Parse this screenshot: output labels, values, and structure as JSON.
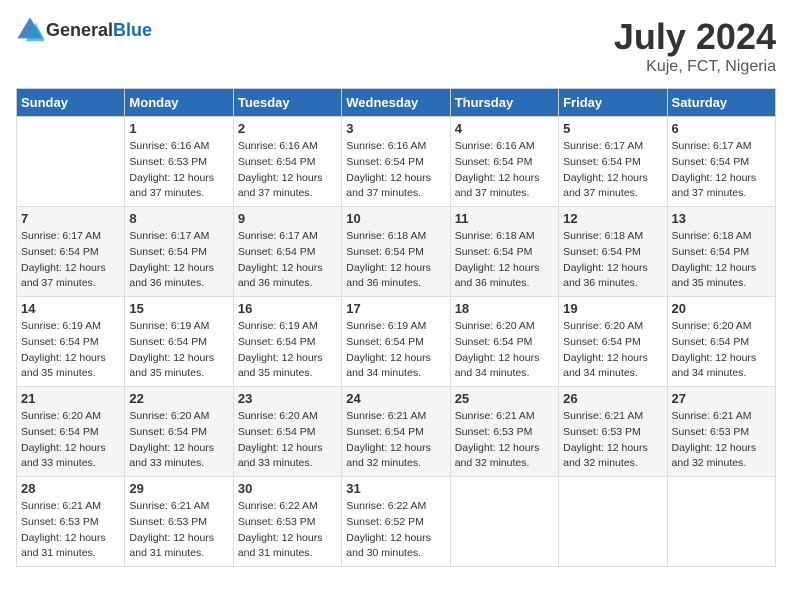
{
  "logo": {
    "general": "General",
    "blue": "Blue"
  },
  "title": "July 2024",
  "location": "Kuje, FCT, Nigeria",
  "days_of_week": [
    "Sunday",
    "Monday",
    "Tuesday",
    "Wednesday",
    "Thursday",
    "Friday",
    "Saturday"
  ],
  "weeks": [
    [
      {
        "day": "",
        "sunrise": "",
        "sunset": "",
        "daylight": ""
      },
      {
        "day": "1",
        "sunrise": "Sunrise: 6:16 AM",
        "sunset": "Sunset: 6:53 PM",
        "daylight": "Daylight: 12 hours and 37 minutes."
      },
      {
        "day": "2",
        "sunrise": "Sunrise: 6:16 AM",
        "sunset": "Sunset: 6:54 PM",
        "daylight": "Daylight: 12 hours and 37 minutes."
      },
      {
        "day": "3",
        "sunrise": "Sunrise: 6:16 AM",
        "sunset": "Sunset: 6:54 PM",
        "daylight": "Daylight: 12 hours and 37 minutes."
      },
      {
        "day": "4",
        "sunrise": "Sunrise: 6:16 AM",
        "sunset": "Sunset: 6:54 PM",
        "daylight": "Daylight: 12 hours and 37 minutes."
      },
      {
        "day": "5",
        "sunrise": "Sunrise: 6:17 AM",
        "sunset": "Sunset: 6:54 PM",
        "daylight": "Daylight: 12 hours and 37 minutes."
      },
      {
        "day": "6",
        "sunrise": "Sunrise: 6:17 AM",
        "sunset": "Sunset: 6:54 PM",
        "daylight": "Daylight: 12 hours and 37 minutes."
      }
    ],
    [
      {
        "day": "7",
        "sunrise": "Sunrise: 6:17 AM",
        "sunset": "Sunset: 6:54 PM",
        "daylight": "Daylight: 12 hours and 37 minutes."
      },
      {
        "day": "8",
        "sunrise": "Sunrise: 6:17 AM",
        "sunset": "Sunset: 6:54 PM",
        "daylight": "Daylight: 12 hours and 36 minutes."
      },
      {
        "day": "9",
        "sunrise": "Sunrise: 6:17 AM",
        "sunset": "Sunset: 6:54 PM",
        "daylight": "Daylight: 12 hours and 36 minutes."
      },
      {
        "day": "10",
        "sunrise": "Sunrise: 6:18 AM",
        "sunset": "Sunset: 6:54 PM",
        "daylight": "Daylight: 12 hours and 36 minutes."
      },
      {
        "day": "11",
        "sunrise": "Sunrise: 6:18 AM",
        "sunset": "Sunset: 6:54 PM",
        "daylight": "Daylight: 12 hours and 36 minutes."
      },
      {
        "day": "12",
        "sunrise": "Sunrise: 6:18 AM",
        "sunset": "Sunset: 6:54 PM",
        "daylight": "Daylight: 12 hours and 36 minutes."
      },
      {
        "day": "13",
        "sunrise": "Sunrise: 6:18 AM",
        "sunset": "Sunset: 6:54 PM",
        "daylight": "Daylight: 12 hours and 35 minutes."
      }
    ],
    [
      {
        "day": "14",
        "sunrise": "Sunrise: 6:19 AM",
        "sunset": "Sunset: 6:54 PM",
        "daylight": "Daylight: 12 hours and 35 minutes."
      },
      {
        "day": "15",
        "sunrise": "Sunrise: 6:19 AM",
        "sunset": "Sunset: 6:54 PM",
        "daylight": "Daylight: 12 hours and 35 minutes."
      },
      {
        "day": "16",
        "sunrise": "Sunrise: 6:19 AM",
        "sunset": "Sunset: 6:54 PM",
        "daylight": "Daylight: 12 hours and 35 minutes."
      },
      {
        "day": "17",
        "sunrise": "Sunrise: 6:19 AM",
        "sunset": "Sunset: 6:54 PM",
        "daylight": "Daylight: 12 hours and 34 minutes."
      },
      {
        "day": "18",
        "sunrise": "Sunrise: 6:20 AM",
        "sunset": "Sunset: 6:54 PM",
        "daylight": "Daylight: 12 hours and 34 minutes."
      },
      {
        "day": "19",
        "sunrise": "Sunrise: 6:20 AM",
        "sunset": "Sunset: 6:54 PM",
        "daylight": "Daylight: 12 hours and 34 minutes."
      },
      {
        "day": "20",
        "sunrise": "Sunrise: 6:20 AM",
        "sunset": "Sunset: 6:54 PM",
        "daylight": "Daylight: 12 hours and 34 minutes."
      }
    ],
    [
      {
        "day": "21",
        "sunrise": "Sunrise: 6:20 AM",
        "sunset": "Sunset: 6:54 PM",
        "daylight": "Daylight: 12 hours and 33 minutes."
      },
      {
        "day": "22",
        "sunrise": "Sunrise: 6:20 AM",
        "sunset": "Sunset: 6:54 PM",
        "daylight": "Daylight: 12 hours and 33 minutes."
      },
      {
        "day": "23",
        "sunrise": "Sunrise: 6:20 AM",
        "sunset": "Sunset: 6:54 PM",
        "daylight": "Daylight: 12 hours and 33 minutes."
      },
      {
        "day": "24",
        "sunrise": "Sunrise: 6:21 AM",
        "sunset": "Sunset: 6:54 PM",
        "daylight": "Daylight: 12 hours and 32 minutes."
      },
      {
        "day": "25",
        "sunrise": "Sunrise: 6:21 AM",
        "sunset": "Sunset: 6:53 PM",
        "daylight": "Daylight: 12 hours and 32 minutes."
      },
      {
        "day": "26",
        "sunrise": "Sunrise: 6:21 AM",
        "sunset": "Sunset: 6:53 PM",
        "daylight": "Daylight: 12 hours and 32 minutes."
      },
      {
        "day": "27",
        "sunrise": "Sunrise: 6:21 AM",
        "sunset": "Sunset: 6:53 PM",
        "daylight": "Daylight: 12 hours and 32 minutes."
      }
    ],
    [
      {
        "day": "28",
        "sunrise": "Sunrise: 6:21 AM",
        "sunset": "Sunset: 6:53 PM",
        "daylight": "Daylight: 12 hours and 31 minutes."
      },
      {
        "day": "29",
        "sunrise": "Sunrise: 6:21 AM",
        "sunset": "Sunset: 6:53 PM",
        "daylight": "Daylight: 12 hours and 31 minutes."
      },
      {
        "day": "30",
        "sunrise": "Sunrise: 6:22 AM",
        "sunset": "Sunset: 6:53 PM",
        "daylight": "Daylight: 12 hours and 31 minutes."
      },
      {
        "day": "31",
        "sunrise": "Sunrise: 6:22 AM",
        "sunset": "Sunset: 6:52 PM",
        "daylight": "Daylight: 12 hours and 30 minutes."
      },
      {
        "day": "",
        "sunrise": "",
        "sunset": "",
        "daylight": ""
      },
      {
        "day": "",
        "sunrise": "",
        "sunset": "",
        "daylight": ""
      },
      {
        "day": "",
        "sunrise": "",
        "sunset": "",
        "daylight": ""
      }
    ]
  ]
}
